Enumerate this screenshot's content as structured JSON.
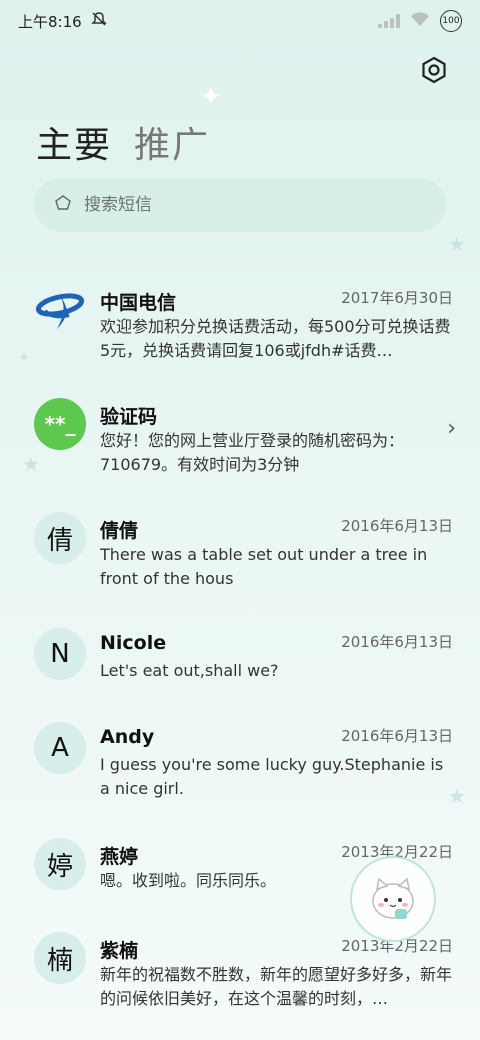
{
  "status": {
    "time": "上午8:16",
    "battery": "100"
  },
  "tabs": [
    {
      "label": "主要"
    },
    {
      "label": "推广"
    }
  ],
  "search": {
    "placeholder": "搜索短信"
  },
  "conversations": [
    {
      "avatar": "",
      "name": "中国电信",
      "date": "2017年6月30日",
      "preview": "欢迎参加积分兑换话费活动，每500分可兑换话费5元，兑换话费请回复106或jfdh#话费…"
    },
    {
      "avatar": "**_",
      "name": "验证码",
      "date": "",
      "preview": "您好！您的网上营业厅登录的随机密码为：710679。有效时间为3分钟"
    },
    {
      "avatar": "倩",
      "name": "倩倩",
      "date": "2016年6月13日",
      "preview": "There was a table set out under a tree in front of the hous"
    },
    {
      "avatar": "N",
      "name": "Nicole",
      "date": "2016年6月13日",
      "preview": "Let's eat out,shall we?"
    },
    {
      "avatar": "A",
      "name": "Andy",
      "date": "2016年6月13日",
      "preview": "I guess you're some lucky guy.Stephanie is a nice girl."
    },
    {
      "avatar": "婷",
      "name": "燕婷",
      "date": "2013年2月22日",
      "preview": "嗯。收到啦。同乐同乐。"
    },
    {
      "avatar": "楠",
      "name": "紫楠",
      "date": "2013年2月22日",
      "preview": "新年的祝福数不胜数，新年的愿望好多好多，新年的问候依旧美好，在这个温馨的时刻，…"
    }
  ],
  "colors": {
    "verification_avatar": "#5cc84e",
    "telecom_blue": "#1f63b8"
  }
}
